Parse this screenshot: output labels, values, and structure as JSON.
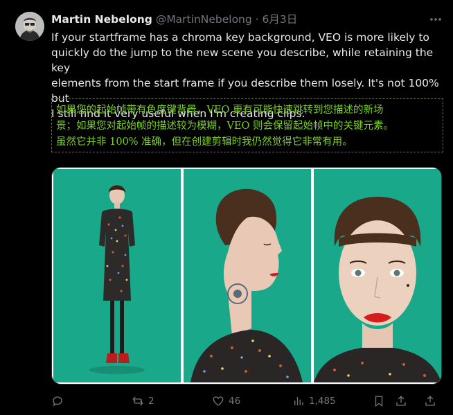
{
  "tweet": {
    "author": {
      "name": "Martin Nebelong",
      "handle": "@MartinNebelong",
      "separator": " · ",
      "date": "6月3日"
    },
    "text_lines": [
      "If your startframe has a chroma key background, VEO is more likely to",
      "quickly do the jump to the new scene you describe, while retaining the key",
      "elements from the start frame if you describe them losely. It's not 100% but",
      "I still find it very useful when I'm creating clips."
    ],
    "translation_lines": [
      "如果您的起始帧带有色度键背景，VEO 更有可能快速跳转到您描述的新场",
      "景；如果您对起始帧的描述较为模糊，VEO 则会保留起始帧中的关键元素。",
      "虽然它并非 100% 准确，但在创建剪辑时我仍然觉得它非常有用。"
    ],
    "media": {
      "images": [
        {
          "name": "full-body-shot"
        },
        {
          "name": "profile-shot"
        },
        {
          "name": "front-face-shot"
        }
      ],
      "background_color": "#1aa88a"
    },
    "actions": {
      "replies": "",
      "reposts": "2",
      "likes": "46",
      "views": "1,485"
    },
    "icons": [
      "more-icon",
      "reply-icon",
      "repost-icon",
      "like-icon",
      "views-icon",
      "bookmark-icon",
      "share-icon"
    ]
  }
}
